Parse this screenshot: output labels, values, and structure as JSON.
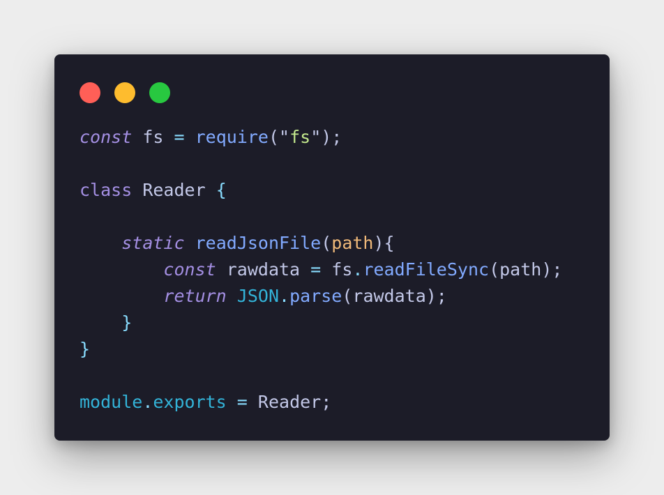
{
  "window": {
    "controls": [
      {
        "name": "close-button",
        "color": "#ff5f57"
      },
      {
        "name": "minimize-button",
        "color": "#febc2e"
      },
      {
        "name": "maximize-button",
        "color": "#28c840"
      }
    ]
  },
  "colors": {
    "keyword": "#a48fe3",
    "plain": "#c3c8e8",
    "function": "#82aaff",
    "string": "#c3e88d",
    "param": "#f0b979",
    "cyan": "#33b3d8",
    "punct": "#89ddff"
  },
  "code": {
    "lines": [
      [
        {
          "t": "const",
          "c": "keyword",
          "i": true
        },
        {
          "t": " fs ",
          "c": "plain"
        },
        {
          "t": "=",
          "c": "punct"
        },
        {
          "t": " ",
          "c": "plain"
        },
        {
          "t": "require",
          "c": "function"
        },
        {
          "t": "(\"",
          "c": "plain"
        },
        {
          "t": "fs",
          "c": "string"
        },
        {
          "t": "\");",
          "c": "plain"
        }
      ],
      [],
      [
        {
          "t": "class",
          "c": "keyword"
        },
        {
          "t": " Reader ",
          "c": "plain"
        },
        {
          "t": "{",
          "c": "punct"
        }
      ],
      [],
      [
        {
          "t": "    ",
          "c": "plain"
        },
        {
          "t": "static",
          "c": "keyword",
          "i": true
        },
        {
          "t": " ",
          "c": "plain"
        },
        {
          "t": "readJsonFile",
          "c": "function"
        },
        {
          "t": "(",
          "c": "plain"
        },
        {
          "t": "path",
          "c": "param"
        },
        {
          "t": "){",
          "c": "plain"
        }
      ],
      [
        {
          "t": "        ",
          "c": "plain"
        },
        {
          "t": "const",
          "c": "keyword",
          "i": true
        },
        {
          "t": " rawdata ",
          "c": "plain"
        },
        {
          "t": "=",
          "c": "punct"
        },
        {
          "t": " fs",
          "c": "plain"
        },
        {
          "t": ".",
          "c": "punct"
        },
        {
          "t": "readFileSync",
          "c": "function"
        },
        {
          "t": "(path);",
          "c": "plain"
        }
      ],
      [
        {
          "t": "        ",
          "c": "plain"
        },
        {
          "t": "return",
          "c": "keyword",
          "i": true
        },
        {
          "t": " ",
          "c": "plain"
        },
        {
          "t": "JSON",
          "c": "cyan"
        },
        {
          "t": ".",
          "c": "punct"
        },
        {
          "t": "parse",
          "c": "function"
        },
        {
          "t": "(rawdata);",
          "c": "plain"
        }
      ],
      [
        {
          "t": "    ",
          "c": "plain"
        },
        {
          "t": "}",
          "c": "punct"
        }
      ],
      [
        {
          "t": "}",
          "c": "punct"
        }
      ],
      [],
      [
        {
          "t": "module",
          "c": "cyan"
        },
        {
          "t": ".",
          "c": "punct"
        },
        {
          "t": "exports",
          "c": "cyan"
        },
        {
          "t": " ",
          "c": "plain"
        },
        {
          "t": "=",
          "c": "punct"
        },
        {
          "t": " Reader;",
          "c": "plain"
        }
      ]
    ]
  }
}
